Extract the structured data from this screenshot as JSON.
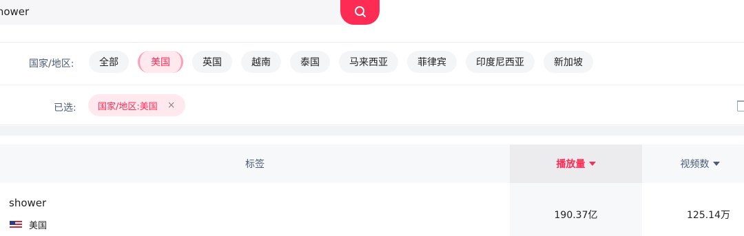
{
  "search": {
    "value": "shower"
  },
  "filters": {
    "label": "国家/地区:",
    "options": [
      "全部",
      "美国",
      "英国",
      "越南",
      "泰国",
      "马来西亚",
      "菲律宾",
      "印度尼西亚",
      "新加坡"
    ],
    "active_index": 1
  },
  "selected": {
    "label": "已选:",
    "chip": "国家/地区:美国",
    "remove": "×"
  },
  "table": {
    "headers": {
      "tag": "标签",
      "views": "播放量",
      "videos": "视频数"
    },
    "rows": [
      {
        "tag": "shower",
        "region": "美国",
        "views": "190.37亿",
        "videos": "125.14万"
      }
    ]
  },
  "colors": {
    "accent": "#fe2c55",
    "label": "#4b5b78"
  },
  "icons": {
    "search": "search-icon",
    "trash": "trash-icon",
    "sort": "caret-down-icon",
    "flag": "us-flag-icon"
  }
}
